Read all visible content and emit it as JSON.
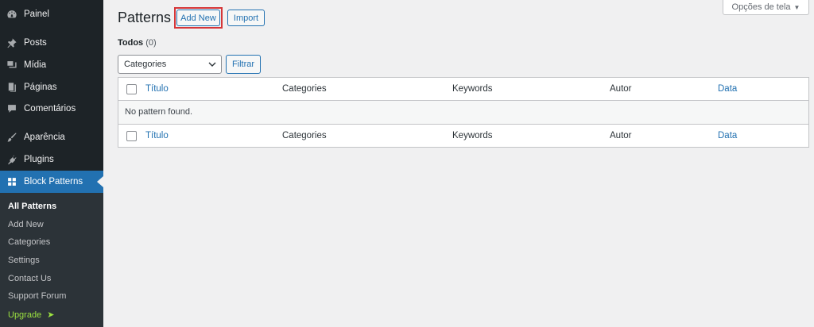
{
  "sidebar": {
    "items": [
      {
        "label": "Painel",
        "icon": "dashboard-icon"
      },
      {
        "label": "Posts",
        "icon": "pushpin-icon"
      },
      {
        "label": "Mídia",
        "icon": "media-icon"
      },
      {
        "label": "Páginas",
        "icon": "pages-icon"
      },
      {
        "label": "Comentários",
        "icon": "comment-icon"
      },
      {
        "label": "Aparência",
        "icon": "brush-icon"
      },
      {
        "label": "Plugins",
        "icon": "plugin-icon"
      },
      {
        "label": "Block Patterns",
        "icon": "grid-icon"
      }
    ],
    "submenu": [
      "All Patterns",
      "Add New",
      "Categories",
      "Settings",
      "Contact Us",
      "Support Forum",
      "Upgrade"
    ],
    "upgrade_arrow": "➤"
  },
  "header": {
    "screen_options": "Opções de tela",
    "screen_options_arrow": "▼",
    "title": "Patterns",
    "add_new": "Add New",
    "import": "Import"
  },
  "filters": {
    "view_label": "Todos",
    "view_count": "(0)",
    "select_value": "Categories",
    "filter_button": "Filtrar"
  },
  "table": {
    "columns": [
      "Título",
      "Categories",
      "Keywords",
      "Autor",
      "Data"
    ],
    "empty_message": "No pattern found."
  },
  "colors": {
    "sidebar_bg": "#1d2327",
    "submenu_bg": "#2c3338",
    "accent": "#2271b1",
    "highlight": "#d63638",
    "upgrade": "#9ce240"
  }
}
